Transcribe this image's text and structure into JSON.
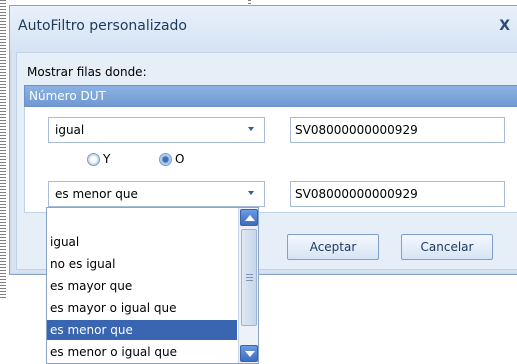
{
  "dialog": {
    "title": "AutoFiltro personalizado",
    "close_glyph": "X",
    "show_rows_label": "Mostrar filas donde:",
    "column_header": "Número DUT"
  },
  "condition1": {
    "operator": "igual",
    "value": "SV08000000000929"
  },
  "logic": {
    "options": [
      "Y",
      "O"
    ],
    "selected": "O"
  },
  "condition2": {
    "operator": "es menor que",
    "value": "SV08000000000929"
  },
  "buttons": {
    "ok": "Aceptar",
    "cancel": "Cancelar"
  },
  "dropdown": {
    "items": [
      "",
      "igual",
      "no es igual",
      "es mayor que",
      "es mayor o igual que",
      "es menor que",
      "es menor o igual que"
    ],
    "selected_index": 5
  },
  "icons": {
    "combo_arrow": "chevron-down-icon",
    "scroll_up": "scroll-up-arrow-icon",
    "scroll_down": "scroll-down-arrow-icon"
  },
  "colors": {
    "selection": "#3a65b1",
    "header": "#7ea6db"
  }
}
